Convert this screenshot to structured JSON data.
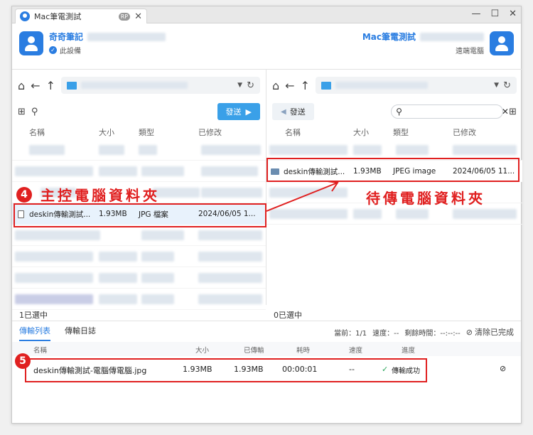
{
  "window": {
    "tab_title": "Mac筆電測試",
    "tab_badge": "RP",
    "tab_close": "✕",
    "minimize": "—",
    "maximize": "☐",
    "close": "✕"
  },
  "local_peer": {
    "name": "奇奇筆記",
    "subtitle": "此設備"
  },
  "remote_peer": {
    "name": "Mac筆電測試",
    "subtitle": "遠端電腦"
  },
  "left_pane": {
    "send_label": "發送",
    "columns": [
      "名稱",
      "大小",
      "類型",
      "已修改"
    ],
    "file": {
      "name": "deskin傳輸測試...",
      "size": "1.93MB",
      "type": "JPG 檔案",
      "modified": "2024/06/05 1..."
    },
    "selected": "1已選中"
  },
  "right_pane": {
    "send_label": "發送",
    "search_placeholder": "",
    "columns": [
      "名稱",
      "大小",
      "類型",
      "已修改"
    ],
    "file": {
      "name": "deskin傳輸測試...",
      "size": "1.93MB",
      "type": "JPEG image",
      "modified": "2024/06/05 11..."
    },
    "selected": "0已選中"
  },
  "annotations": {
    "badge4": "4",
    "label_left": "主控電腦資料夾",
    "label_right": "待傳電腦資料夾",
    "badge5": "5"
  },
  "transfer": {
    "tabs": [
      "傳輸列表",
      "傳輸日誌"
    ],
    "status": {
      "current": "當前：1/1",
      "speed": "速度：--",
      "remaining": "剩餘時間：--:--:--",
      "clear": "清除已完成"
    },
    "headers": [
      "名稱",
      "大小",
      "已傳輸",
      "耗時",
      "速度",
      "進度"
    ],
    "row": {
      "name": "deskin傳輸測試-電腦傳電腦.jpg",
      "size": "1.93MB",
      "transferred": "1.93MB",
      "elapsed": "00:00:01",
      "speed": "--",
      "progress": "傳輸成功"
    }
  },
  "colors": {
    "accent": "#2a7de1",
    "annotation": "#e02020",
    "success": "#2aa55a"
  }
}
